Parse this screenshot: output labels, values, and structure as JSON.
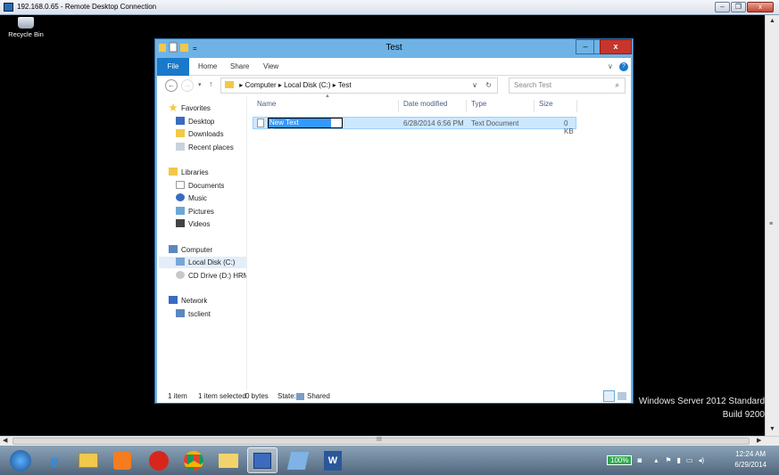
{
  "rdp": {
    "title": "192.168.0.65 - Remote Desktop Connection"
  },
  "desktop": {
    "recycle_bin": "Recycle Bin",
    "watermark_line1": "Windows Server 2012 Standard",
    "watermark_line2": "Build 9200"
  },
  "explorer": {
    "title": "Test",
    "window_buttons": {
      "minimize": "–",
      "maximize": "□",
      "close": "x"
    },
    "ribbon_tabs": [
      "File",
      "Home",
      "Share",
      "View"
    ],
    "address": {
      "parts": [
        "Computer",
        "Local Disk (C:)",
        "Test"
      ],
      "sep": "▸"
    },
    "search_placeholder": "Search Test",
    "nav": {
      "favorites": "Favorites",
      "fav_items": [
        "Desktop",
        "Downloads",
        "Recent places"
      ],
      "libraries": "Libraries",
      "lib_items": [
        "Documents",
        "Music",
        "Pictures",
        "Videos"
      ],
      "computer": "Computer",
      "comp_items": [
        "Local Disk (C:)",
        "CD Drive (D:) HRM_S"
      ],
      "network": "Network",
      "net_items": [
        "tsclient"
      ]
    },
    "columns": [
      "Name",
      "Date modified",
      "Type",
      "Size"
    ],
    "files": [
      {
        "name": "New Text Document",
        "date": "6/28/2014 6:56 PM",
        "type": "Text Document",
        "size": "0 KB"
      }
    ],
    "status": {
      "count": "1 item",
      "selected": "1 item selected",
      "bytes": "0 bytes",
      "state_label": "State:",
      "state_value": "Shared"
    }
  },
  "taskbar": {
    "battery": "100%",
    "time": "12:24 AM",
    "date": "6/29/2014"
  },
  "colors": {
    "accent": "#1979ca",
    "window_frame": "#6fb3e6",
    "close": "#c7362c",
    "selection": "#cce8ff"
  }
}
